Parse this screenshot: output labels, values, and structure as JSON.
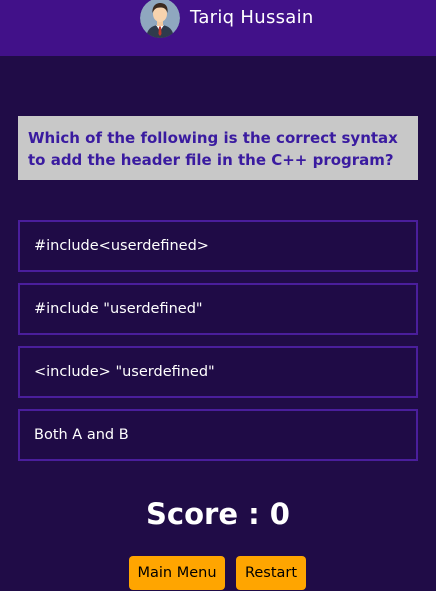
{
  "header": {
    "user_name": "Tariq Hussain",
    "avatar_icon": "user-avatar-icon",
    "background_color": "#411189"
  },
  "question": {
    "text": "Which of the following is the correct syntax to add the header file in the C++ program?"
  },
  "options": [
    {
      "label": "#include<userdefined>"
    },
    {
      "label": "#include \"userdefined\""
    },
    {
      "label": "<include> \"userdefined\""
    },
    {
      "label": "Both A and B"
    }
  ],
  "score": {
    "text": "Score : 0"
  },
  "buttons": {
    "main_menu": "Main Menu",
    "restart": "Restart",
    "color": "#ffa500"
  },
  "page": {
    "background_color": "#200c47"
  }
}
